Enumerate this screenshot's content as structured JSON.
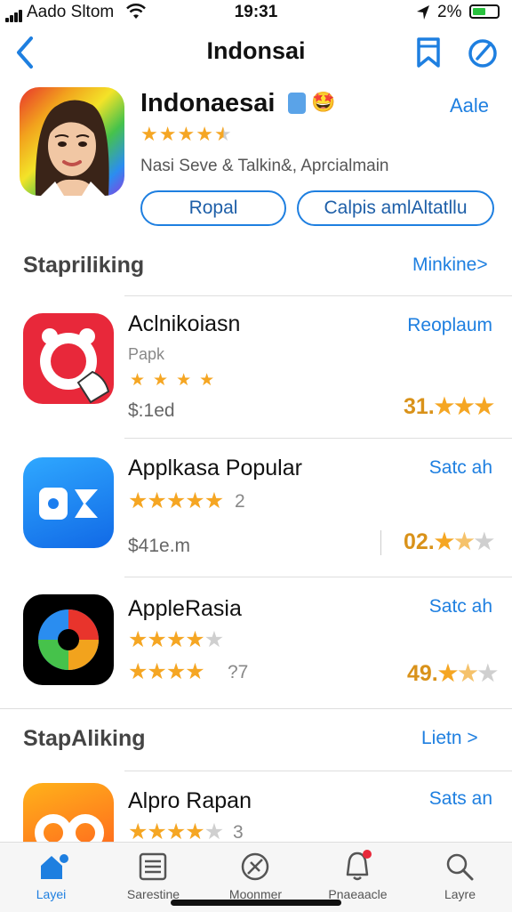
{
  "status": {
    "carrier": "Aado Sltom",
    "time": "19:31",
    "battery": "2%"
  },
  "nav": {
    "title": "Indonsai"
  },
  "hero": {
    "name": "Indonaesai",
    "emoji": "🤩",
    "action": "Aale",
    "subtitle": "Nasi Seve & Talkin&, Aprcialmain",
    "button1": "Ropal",
    "button2": "Calpis amlAltatllu",
    "rating": 4.5
  },
  "sections": [
    {
      "title": "Stapriliking",
      "see_all": "Minkine",
      "apps": [
        {
          "name": "Aclnikoiasn",
          "meta": "Papk",
          "price": "$:1ed",
          "action": "Reoplaum",
          "rating_text": "31.",
          "stars": 4
        },
        {
          "name": "Applkasa Popular",
          "meta": "2",
          "price": "$41e.m",
          "action": "Satc ah",
          "rating_text": "02.",
          "stars": 5
        },
        {
          "name": "AppleRasia",
          "meta": "?7",
          "price": "",
          "action": "Satc ah",
          "rating_text": "49.",
          "stars": 4
        }
      ]
    },
    {
      "title": "StapAliking",
      "see_all": "Lietn",
      "apps": [
        {
          "name": "Alpro Rapan",
          "meta": "3",
          "action": "Sats an",
          "stars": 4
        }
      ]
    }
  ],
  "tabs": [
    {
      "label": "Layei",
      "icon": "home-icon",
      "active": true
    },
    {
      "label": "Sarestine",
      "icon": "list-icon",
      "active": false
    },
    {
      "label": "Moonmer",
      "icon": "compass-icon",
      "active": false
    },
    {
      "label": "Pnaeaacle",
      "icon": "notification-icon",
      "active": false
    },
    {
      "label": "Layre",
      "icon": "search-icon",
      "active": false
    }
  ],
  "colors": {
    "accent": "#1e7fe0",
    "star": "#f5a623"
  }
}
